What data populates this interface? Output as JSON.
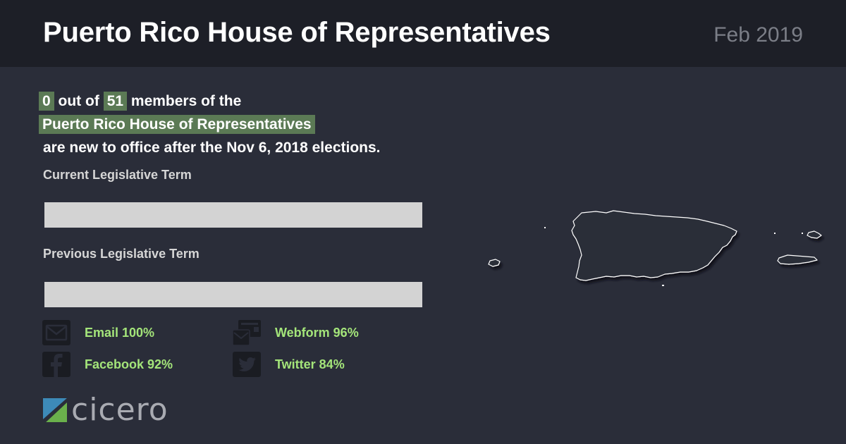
{
  "header": {
    "title": "Puerto Rico House of Representatives",
    "date": "Feb 2019"
  },
  "summary": {
    "new_count": "0",
    "out_of_text": "out of",
    "total_count": "51",
    "members_text": "members of the",
    "chamber_name": "Puerto Rico House of Representatives",
    "closing_text": "are new to office after the Nov 6, 2018 elections."
  },
  "terms": {
    "current_label": "Current Legislative Term",
    "previous_label": "Previous Legislative Term"
  },
  "contacts": [
    {
      "label": "Email 100%",
      "icon": "email-icon"
    },
    {
      "label": "Webform 96%",
      "icon": "webform-icon"
    },
    {
      "label": "Facebook 92%",
      "icon": "facebook-icon"
    },
    {
      "label": "Twitter 84%",
      "icon": "twitter-icon"
    }
  ],
  "logo": {
    "text": "cicero"
  },
  "colors": {
    "background": "#2a2d39",
    "header": "#1d1f27",
    "highlight": "#5b7a55",
    "accent_text": "#a4e57a",
    "bar": "#d3d3d3"
  }
}
